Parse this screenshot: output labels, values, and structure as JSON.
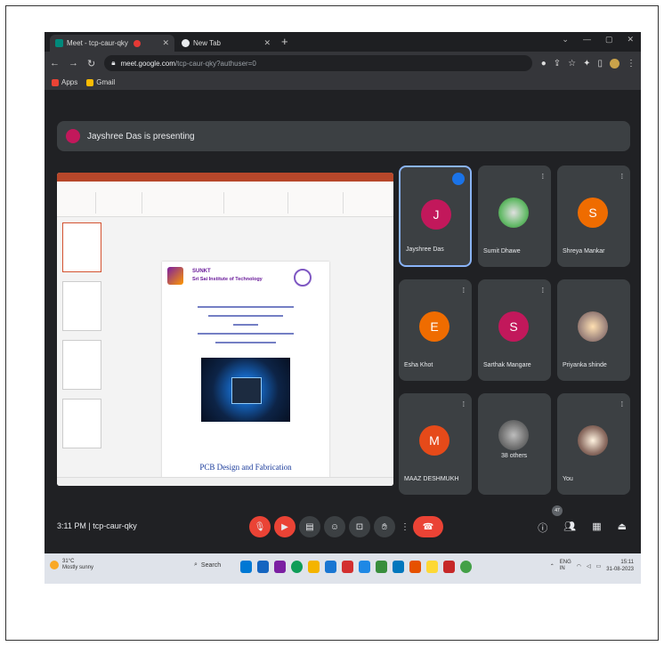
{
  "browser": {
    "tabs": [
      {
        "title": "Meet - tcp-caur-qky",
        "active": true
      },
      {
        "title": "New Tab",
        "active": false
      }
    ],
    "url_host": "meet.google.com",
    "url_path": "/tcp-caur-qky?authuser=0",
    "bookmarks": [
      "Apps",
      "Gmail"
    ]
  },
  "banner": {
    "text": "Jayshree Das is presenting"
  },
  "slide": {
    "institute_name": "SUNKT",
    "institute_subtitle": "Sri Sai Institute of Technology",
    "lines": 5,
    "caption": "PCB Design and Fabrication"
  },
  "participants": [
    {
      "name": "Jayshree Das",
      "initial": "J",
      "color": "#c2185b"
    },
    {
      "name": "Sumit Dhawe",
      "initial": "",
      "color": "#4caf50"
    },
    {
      "name": "Shreya Mankar",
      "initial": "S",
      "color": "#ef6c00"
    },
    {
      "name": "Esha Khot",
      "initial": "E",
      "color": "#ef6c00"
    },
    {
      "name": "Sarthak Mangare",
      "initial": "S",
      "color": "#c2185b"
    },
    {
      "name": "Priyanka shinde",
      "initial": "",
      "color": "#a1887f"
    },
    {
      "name": "MAAZ DESHMUKH",
      "initial": "M",
      "color": "#e64a19"
    },
    {
      "name": "38 others",
      "initial": "",
      "color": "#5f6368"
    },
    {
      "name": "You",
      "initial": "",
      "color": "#8d6e63"
    }
  ],
  "controls": {
    "time": "3:11 PM",
    "meeting_code": "tcp-caur-qky",
    "participant_badge": "47"
  },
  "taskbar": {
    "weather_temp": "31°C",
    "weather_desc": "Mostly sunny",
    "search_label": "Search",
    "lang": "ENG\nIN",
    "time": "15:11",
    "date": "31-08-2023"
  },
  "colors": {
    "meet_bg": "#202124",
    "tile_bg": "#3c4043",
    "danger": "#ea4335",
    "accent": "#8ab4f8"
  }
}
